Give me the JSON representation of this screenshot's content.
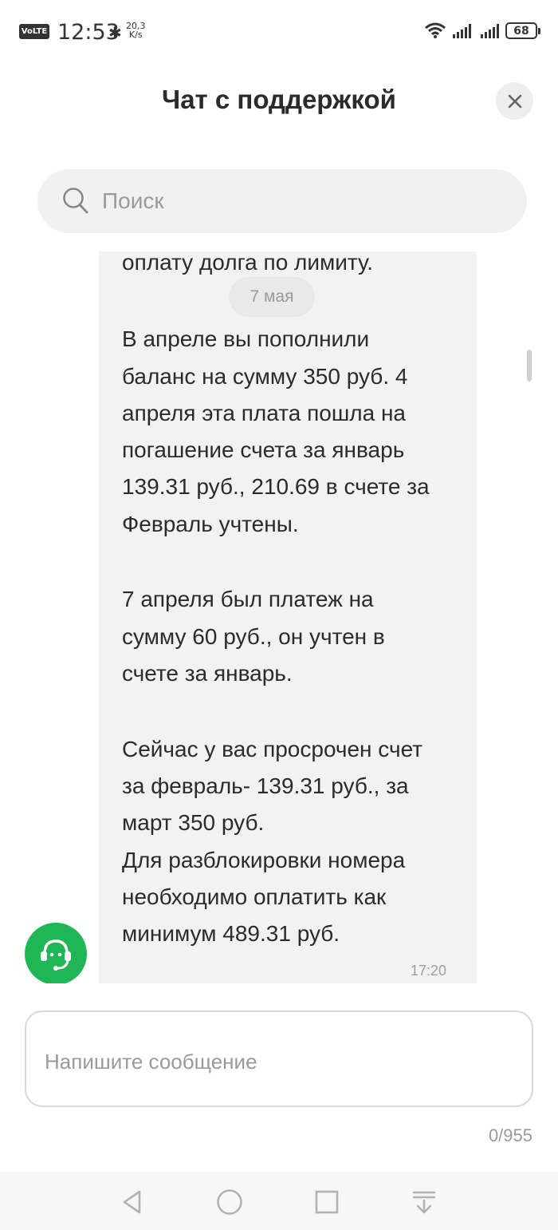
{
  "status_bar": {
    "volte": "VoLTE",
    "time": "12:53",
    "net_speed_value": "20,3",
    "net_speed_unit": "K/s",
    "battery": "68",
    "icons": [
      "bluetooth-icon",
      "wifi-icon",
      "signal-icon",
      "signal-icon",
      "battery-icon"
    ]
  },
  "header": {
    "title": "Чат с поддержкой",
    "close_icon": "close-icon"
  },
  "search": {
    "placeholder": "Поиск",
    "icon": "search-icon"
  },
  "chat": {
    "date_chip": "7 мая",
    "message": {
      "lines": [
        "оплату долга по лимиту.",
        "В апреле вы пополнили",
        "баланс на сумму 350 руб. 4",
        "апреля эта плата пошла на",
        "погашение счета за январь",
        "139.31 руб., 210.69 в счете за",
        "Февраль учтены.",
        "7 апреля был платеж на",
        "сумму 60 руб., он учтен в",
        "счете за январь.",
        "Сейчас у вас просрочен счет",
        "за февраль- 139.31 руб., за",
        "март 350 руб.",
        "Для разблокировки номера",
        "необходимо оплатить как",
        "минимум 489.31 руб."
      ],
      "time": "17:20"
    },
    "avatar_icon": "support-agent-icon",
    "bubble_color": "#f2f2f2",
    "avatar_color": "#1fb655"
  },
  "composer": {
    "placeholder": "Напишите сообщение",
    "counter": "0/955"
  },
  "nav": {
    "icons": [
      "back-icon",
      "home-icon",
      "recents-icon",
      "notifications-pull-icon"
    ]
  }
}
